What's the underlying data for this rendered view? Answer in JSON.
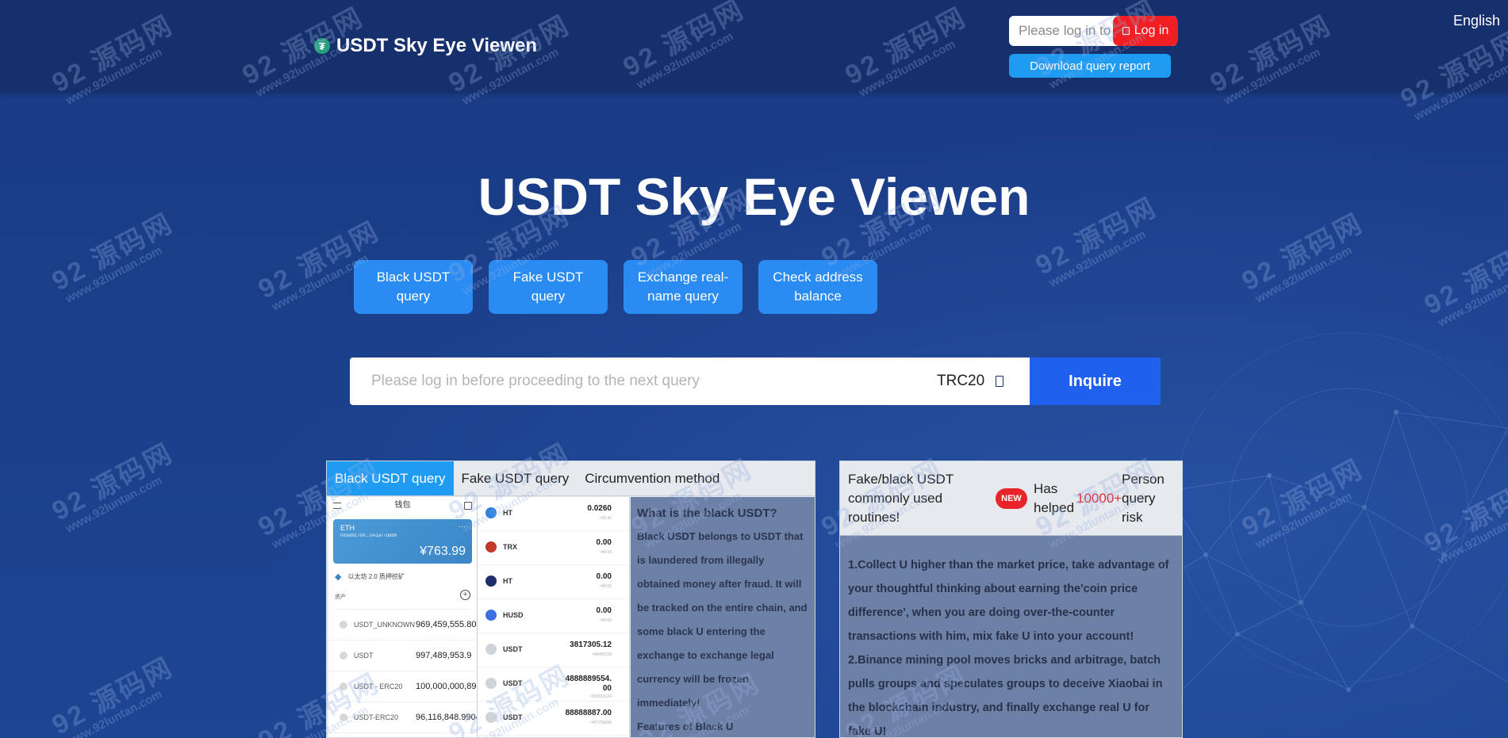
{
  "header": {
    "brand": "USDT Sky Eye Viewen",
    "brand_icon": "tether-icon",
    "login_placeholder": "Please log in to",
    "login_button": "Log in",
    "download_button": "Download query report",
    "language": "English"
  },
  "hero": {
    "title": "USDT Sky Eye Viewen",
    "buttons": [
      "Black USDT query",
      "Fake USDT query",
      "Exchange real-name query",
      "Check address balance"
    ]
  },
  "search": {
    "placeholder": "Please log in before proceeding to the next query",
    "chain": "TRC20",
    "inquire": "Inquire"
  },
  "left_panel": {
    "tabs": [
      "Black USDT query",
      "Fake USDT query",
      "Circumvention method"
    ],
    "active_tab": 0,
    "wallet": {
      "header": "钱包",
      "card_name": "ETH",
      "card_address": "0x5af9170A...0A1a77da98",
      "card_balance": "¥763.99",
      "mining_label": "以太坊 2.0 质押挖矿",
      "assets_label": "资产",
      "assets": [
        {
          "name": "USDT_UNKNOWN",
          "value": "969,459,555.80"
        },
        {
          "name": "USDT",
          "value": "997,489,953.9"
        },
        {
          "name": "USDT - ERC20",
          "value": "100,000,000,89"
        },
        {
          "name": "USDT-ERC20",
          "value": "96,116,848.9904"
        }
      ]
    },
    "coins": [
      {
        "name": "HT",
        "amount": "0.0260",
        "sub": "≈¥3.41",
        "color": "#2f7fe0"
      },
      {
        "name": "TRX",
        "amount": "0.00",
        "sub": "≈¥0.00",
        "color": "#c0392b"
      },
      {
        "name": "HT",
        "amount": "0.00",
        "sub": "≈¥0.00",
        "color": "#1c2f6b"
      },
      {
        "name": "HUSD",
        "amount": "0.00",
        "sub": "≈¥0.00",
        "color": "#3f6fe6"
      },
      {
        "name": "USDT",
        "amount": "3817305.12",
        "sub": "≈¥6490729",
        "color": "#cfd3da"
      },
      {
        "name": "USDT",
        "amount": "4888889554.\n00",
        "sub": "≈¥33312124",
        "color": "#cfd3da"
      },
      {
        "name": "USDT",
        "amount": "88888887.00",
        "sub": "≈¥57755936",
        "color": "#cfd3da"
      }
    ],
    "info_title": "What is the black USDT?",
    "info_body": "Black USDT belongs to USDT that is laundered from illegally obtained money after fraud. It will be tracked on the entire chain, and some black U entering the exchange to exchange legal currency will be frozen immediately!",
    "info_next": "Features of Black U"
  },
  "right_panel": {
    "title": "Fake/black USDT commonly used routines!",
    "badge": "NEW",
    "helped": "Has helped",
    "count": "10000+",
    "person": "Person query risk",
    "body": "1.Collect U higher than the market price, take advantage of your thoughtful thinking about earning the'coin price difference', when you are doing over-the-counter transactions with him, mix fake U into your account!\n2.Binance mining pool moves bricks and arbitrage, batch pulls groups and speculates groups to deceive Xiaobai in the blockchain industry, and finally exchange real U for fake U!"
  },
  "watermark": {
    "big": "92 源码网",
    "small": "www.92luntan.com"
  },
  "colors": {
    "accent": "#2a8bf2",
    "danger": "#ef1f24",
    "background": "#1b3a82",
    "inquire": "#2060ee"
  }
}
